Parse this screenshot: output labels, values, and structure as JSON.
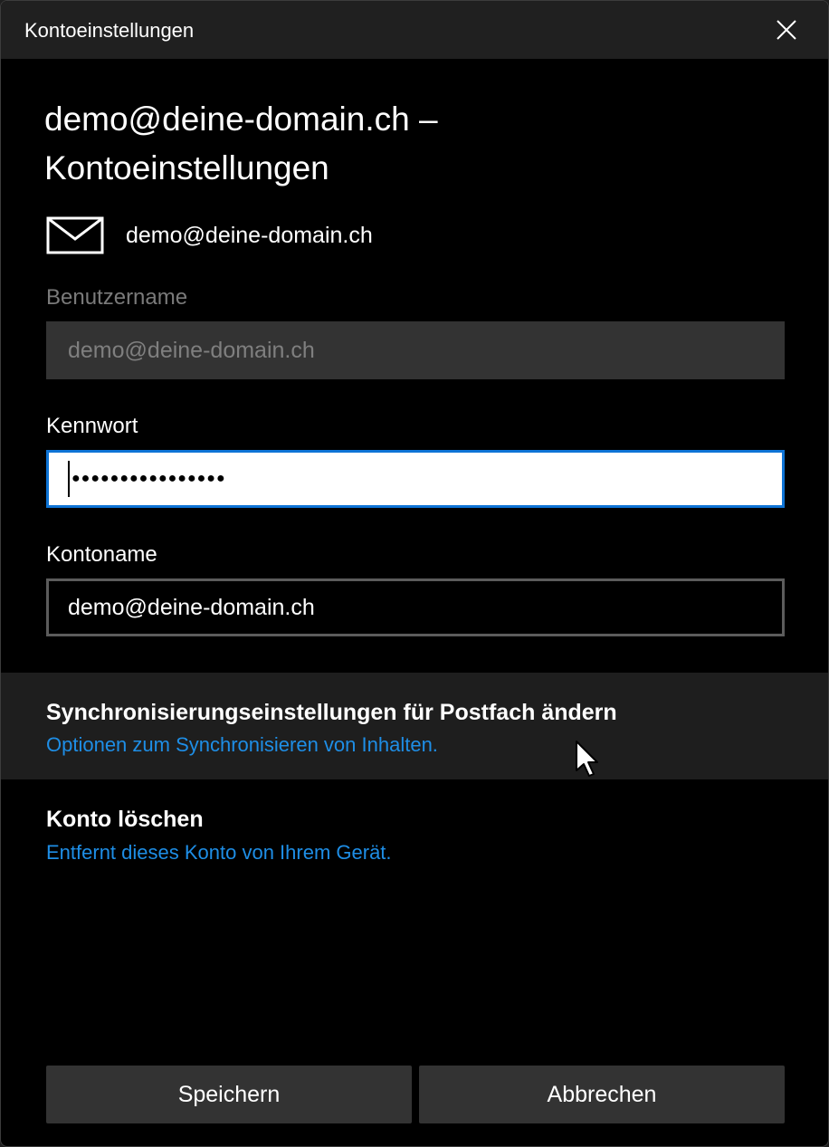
{
  "window": {
    "title": "Kontoeinstellungen"
  },
  "heading": "demo@deine-domain.ch – Kontoeinstellungen",
  "account": {
    "email": "demo@deine-domain.ch",
    "icon": "mail-icon"
  },
  "fields": {
    "username": {
      "label": "Benutzername",
      "value": "demo@deine-domain.ch",
      "disabled": true
    },
    "password": {
      "label": "Kennwort",
      "masked_value": "●●●●●●●●●●●●●●●●",
      "focused": true
    },
    "account_name": {
      "label": "Kontoname",
      "value": "demo@deine-domain.ch"
    }
  },
  "options": {
    "sync": {
      "title": "Synchronisierungseinstellungen für Postfach ändern",
      "subtitle": "Optionen zum Synchronisieren von Inhalten."
    },
    "delete": {
      "title": "Konto löschen",
      "subtitle": "Entfernt dieses Konto von Ihrem Gerät."
    }
  },
  "buttons": {
    "save": "Speichern",
    "cancel": "Abbrechen"
  },
  "colors": {
    "accent": "#0e74d6",
    "link": "#1e8ee6",
    "background": "#000000",
    "control": "#333333"
  }
}
